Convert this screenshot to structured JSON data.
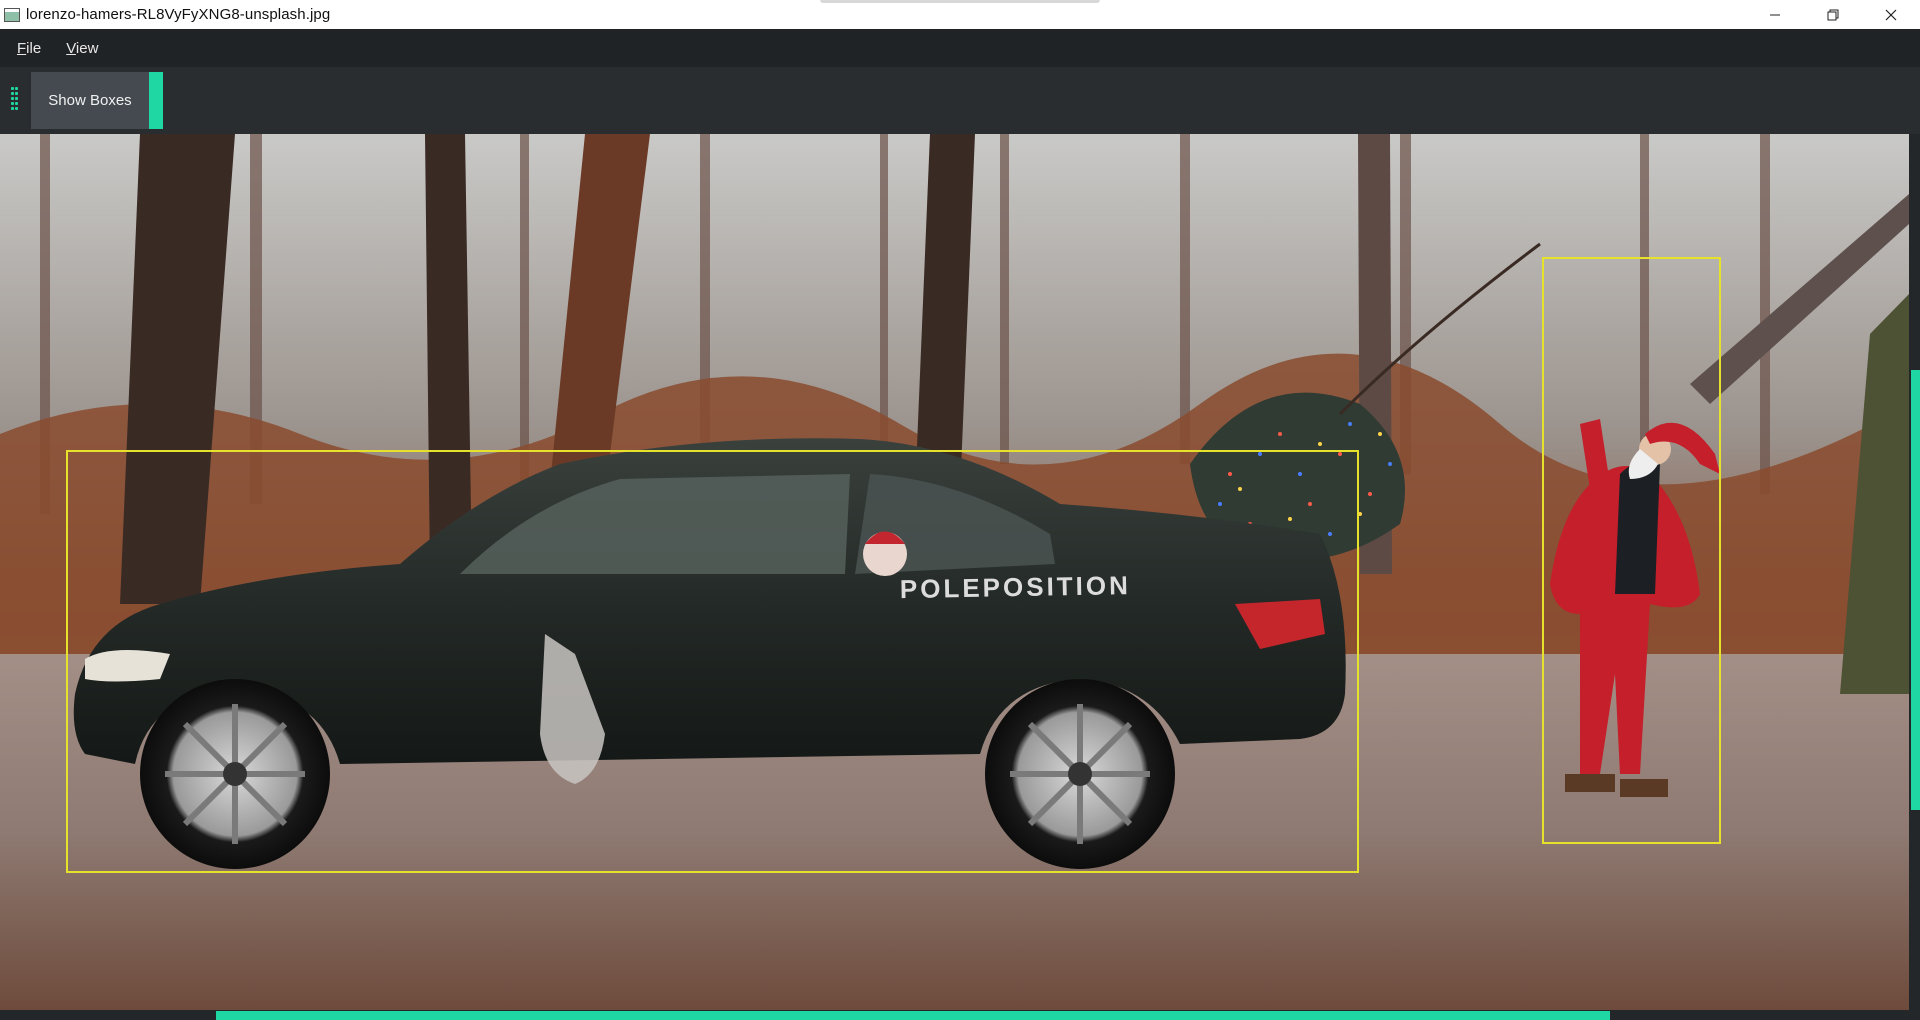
{
  "window": {
    "title": "lorenzo-hamers-RL8VyFyXNG8-unsplash.jpg",
    "controls": [
      "minimize",
      "restore",
      "close"
    ]
  },
  "menu": {
    "file": {
      "mnemonic": "F",
      "rest": "ile"
    },
    "view": {
      "mnemonic": "V",
      "rest": "iew"
    }
  },
  "toolbar": {
    "show_boxes_label": "Show Boxes"
  },
  "image": {
    "decal_text": "POLEPOSITION",
    "detections": [
      "car",
      "person"
    ]
  },
  "colors": {
    "accent": "#1fd7a3",
    "box": "#e6e12a",
    "background": "#1e2124"
  },
  "icons": {
    "app": "image-viewer-icon",
    "minimize": "minimize-icon",
    "restore": "restore-icon",
    "close": "close-icon",
    "grip": "toolbar-grip-icon"
  }
}
